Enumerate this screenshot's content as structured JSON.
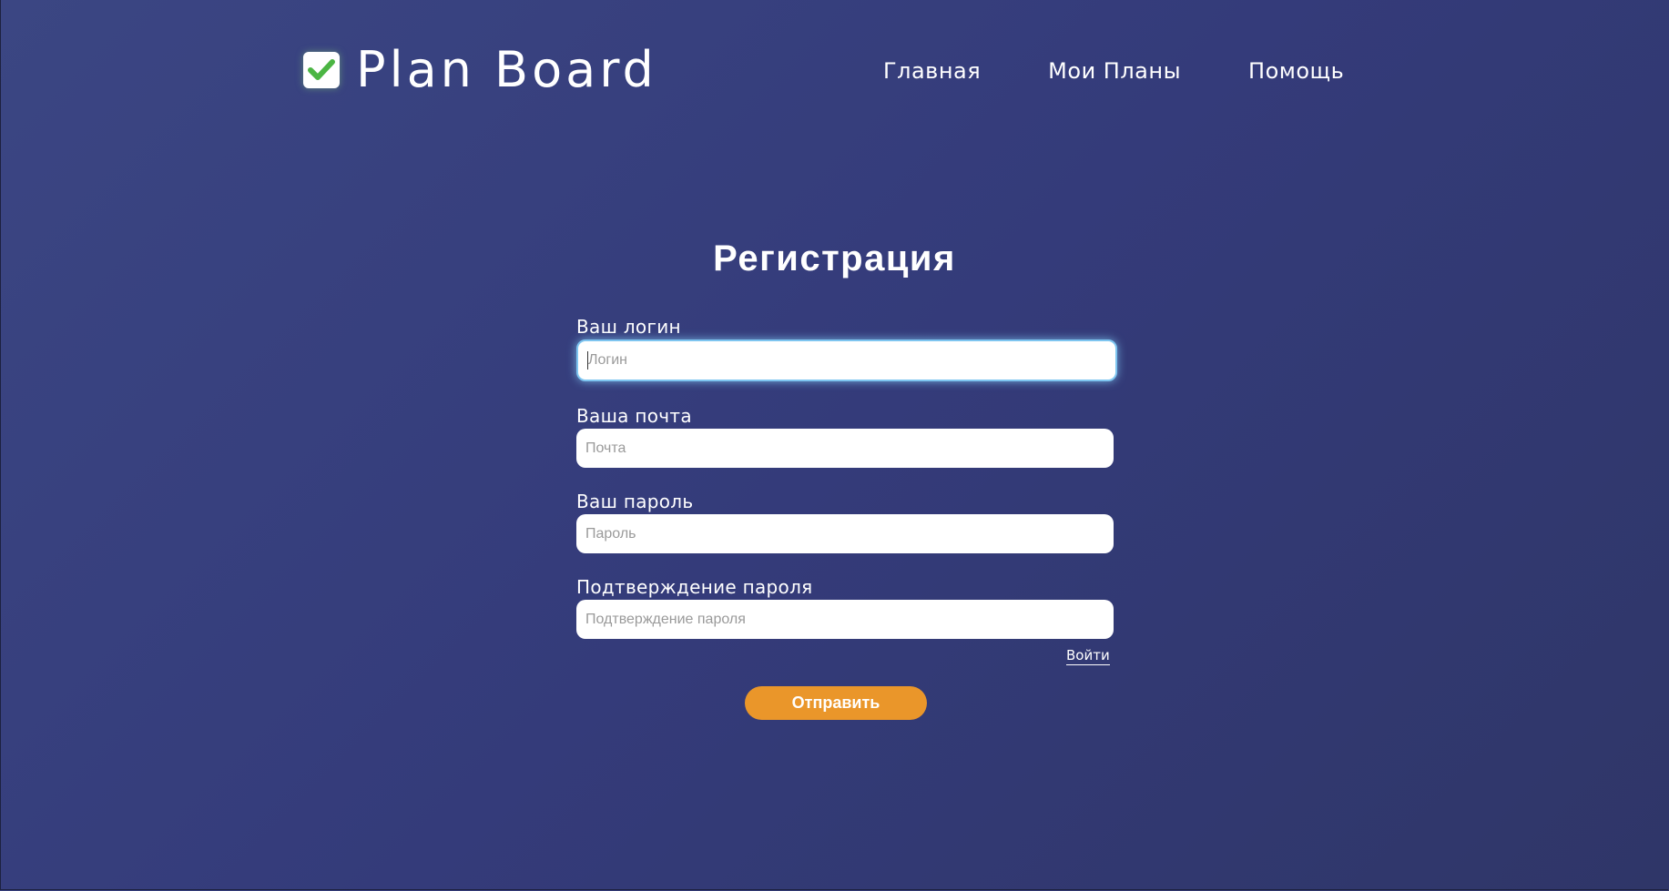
{
  "header": {
    "brand": "Plan Board",
    "brand_icon": "checkbox-check-icon",
    "nav": [
      {
        "label": "Главная"
      },
      {
        "label": "Мои Планы"
      },
      {
        "label": "Помощь"
      }
    ]
  },
  "form": {
    "title": "Регистрация",
    "fields": [
      {
        "label": "Ваш логин",
        "placeholder": "Логин",
        "value": ""
      },
      {
        "label": "Ваша почта",
        "placeholder": "Почта",
        "value": ""
      },
      {
        "label": "Ваш пароль",
        "placeholder": "Пароль",
        "value": ""
      },
      {
        "label": "Подтверждение пароля",
        "placeholder": "Подтверждение пароля",
        "value": ""
      }
    ],
    "login_link": "Войти",
    "submit_label": "Отправить"
  },
  "colors": {
    "background": "#363e7c",
    "accent": "#ea962a",
    "check": "#4bb543",
    "focus": "#7ec5f0"
  }
}
